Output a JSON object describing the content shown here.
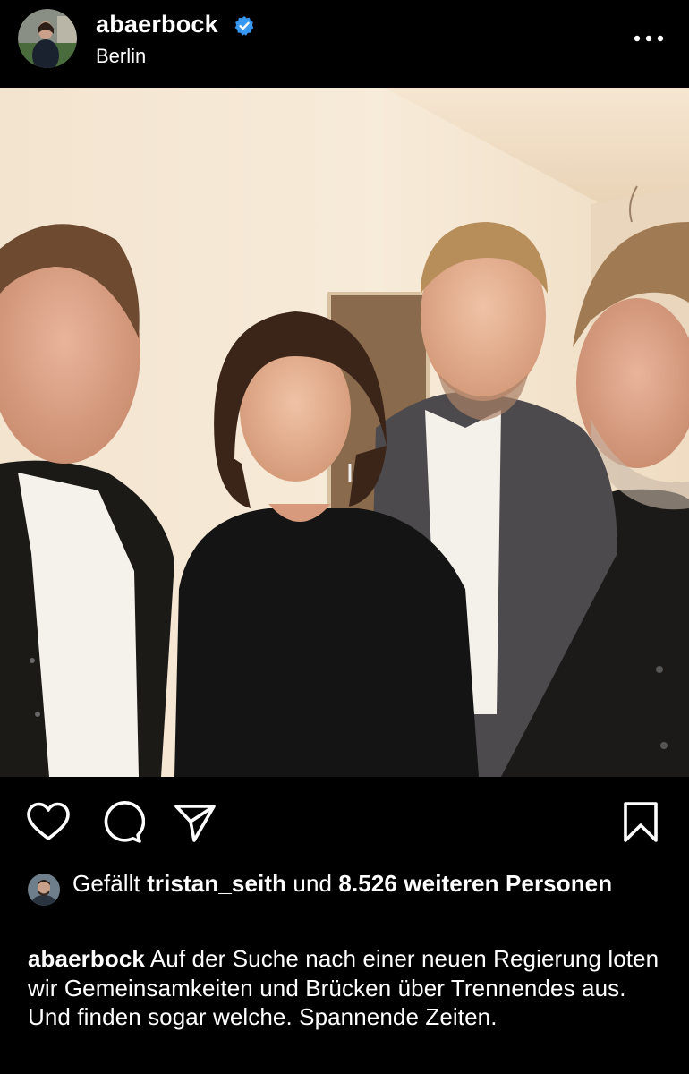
{
  "post_header": {
    "username": "abaerbock",
    "location": "Berlin",
    "verified": true,
    "more_icon": "more-horizontal-icon"
  },
  "actions": {
    "like_icon": "heart-icon",
    "comment_icon": "comment-icon",
    "share_icon": "send-icon",
    "save_icon": "bookmark-icon"
  },
  "likes": {
    "prefix": "Gefällt",
    "user": "tristan_seith",
    "connector": "und",
    "count_text": "8.526 weiteren",
    "suffix": "Personen"
  },
  "caption": {
    "username": "abaerbock",
    "text": "Auf der Suche nach einer neuen Regierung loten wir Gemeinsamkeiten und Brücken über Trennendes aus. Und finden sogar welche. Spannende Zeiten."
  },
  "colors": {
    "background": "#000000",
    "text": "#ffffff",
    "verified_blue": "#3897f0"
  }
}
